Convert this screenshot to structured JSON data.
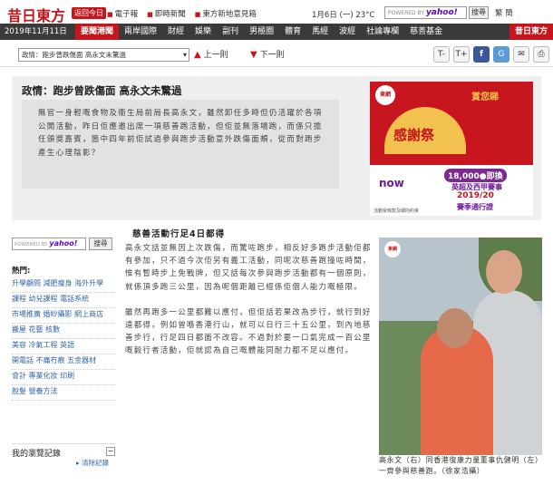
{
  "header": {
    "logo": "昔日東方",
    "today_button": "返回今日",
    "links": [
      "電子報",
      "即時新聞",
      "東方新地意見箱"
    ],
    "date_weather": "1月6日 (一) 23°C",
    "search_placeholder": "POWERED BY",
    "search_brand": "yahoo!",
    "search_button": "搜尋",
    "mini_links": "繁 簡"
  },
  "nav": {
    "date": "2019年11月11日 (一)",
    "items": [
      "要聞港聞",
      "兩岸國際",
      "財經",
      "娛樂",
      "副刊",
      "男極圈",
      "體育",
      "馬經",
      "波經",
      "社論專欄",
      "慈善基金"
    ],
    "active_index": 0,
    "logo": "昔日東方"
  },
  "toolbar": {
    "selected_article": "政情：跑步曾跌傷面 高永文未驚過",
    "prev_label": "上一則",
    "next_label": "下一則",
    "font_smaller": "T-",
    "font_larger": "T+",
    "facebook": "f",
    "google": "G",
    "email": "✉",
    "print": "⎙"
  },
  "article": {
    "headline": "政情：跑步曾跌傷面 高永文未驚過",
    "summary": "無官一身輕嘅食物及衞生局前局長高永文，雖然卸任多時但仍活躍於各項公開活動，昨日佢應邀出席一項慈善跑活動，但佢並無落場跑，而係只擔任頒獎嘉賓，箇中四年前佢試過參與跑步活動意外跌傷面頰，從而對跑步產生心理陰影？",
    "subhead": "慈善活動行足4日都得",
    "paragraphs": [
      "高永文話並無因上次跌傷，而驚咗跑步，相反好多跑步活動佢都有參加，只不過今次佢另有義工活動，同呢次慈善跑撞咗時間，惟有暫時步上免戰牌，但又話每次參與跑步活動都有一個原則，就係頂多跑三公里，因為呢個距離已經係佢個人能力嘅極限。",
      "雖然再跑多一公里都難以應付，但佢話若果改為步行，就行到好遠都得，例如曾喺香港行山，就可以日行三十五公里，到內地慈善步行，行足四日都面不改容。不過對於要一口氣完成一百公里嘅毅行者活動，佢就認為自己嘅體能同耐力都不足以應付。"
    ],
    "photo_caption": "高永文（右）同香港復康力量董事仇健明（左）一齊參與慈善跑。（徐家浩攝）"
  },
  "ad": {
    "slogan": "賞您睇",
    "fan_text": "感謝祭",
    "brand": "now",
    "price": "18,000●即換",
    "league": "英超及西甲賽事",
    "season": "2019/20",
    "pass": "賽季通行證",
    "fine_print": "活動受條款及細則約束",
    "badge": "東網"
  },
  "sidebar": {
    "search_placeholder": "POWERED BY",
    "search_brand": "yahoo!",
    "search_button": "搜尋",
    "hot_title": "熱門:",
    "hot_items": [
      "升學顧問 減肥瘦身 海外升學",
      "課程 幼兒課程 電話系統",
      "市場推廣 婚紗攝影 網上商店",
      "搬屋 花藝 核數",
      "美容 冷氣工程 英語",
      "開電話 不痛冇痕 五金器材",
      "會計 專業化妝 印刷",
      "脫髮 營養方法"
    ],
    "history_title": "我的瀏覽記錄",
    "history_toggle": "−",
    "clear_history": "清除記錄"
  }
}
